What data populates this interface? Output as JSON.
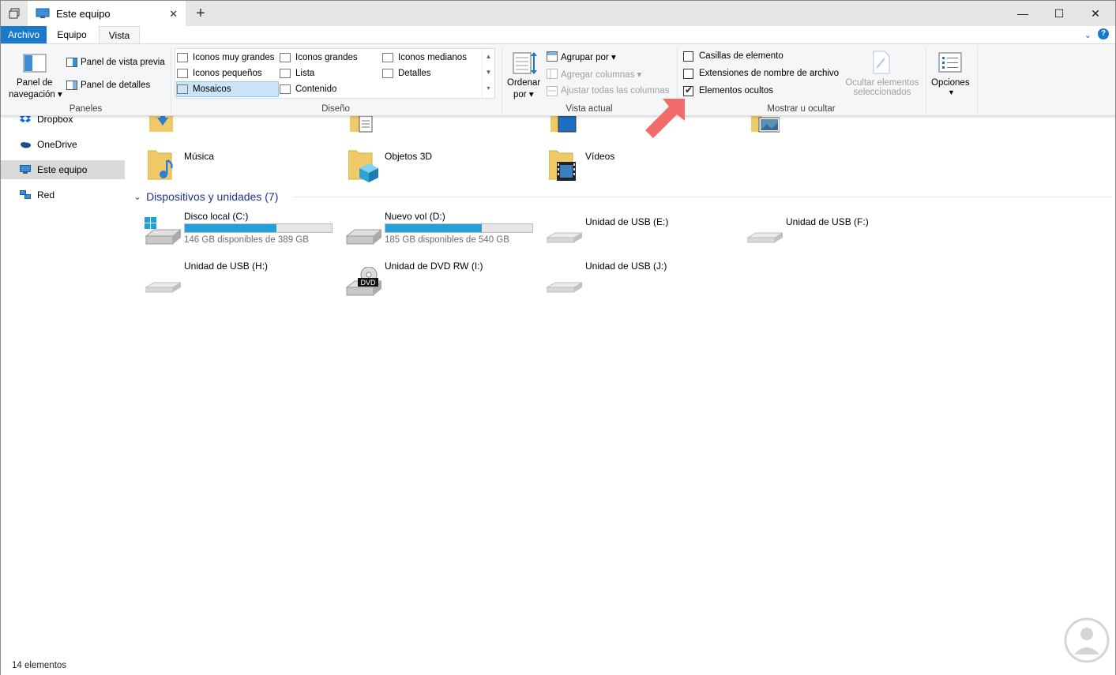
{
  "window": {
    "tab_title": "Este equipo"
  },
  "ribbon_tabs": {
    "archivo": "Archivo",
    "equipo": "Equipo",
    "vista": "Vista"
  },
  "panes": {
    "navigation_pane": "Panel de\nnavegación",
    "navigation_pane_line1": "Panel de",
    "navigation_pane_line2": "navegación",
    "preview_pane": "Panel de vista previa",
    "details_pane": "Panel de detalles",
    "group_label": "Paneles"
  },
  "layout": {
    "options": [
      "Iconos muy grandes",
      "Iconos grandes",
      "Iconos medianos",
      "Iconos pequeños",
      "Lista",
      "Detalles",
      "Mosaicos",
      "Contenido"
    ],
    "selected": "Mosaicos",
    "group_label": "Diseño"
  },
  "current_view": {
    "sort_line1": "Ordenar",
    "sort_line2": "por",
    "group_by": "Agrupar por",
    "add_columns": "Agregar columnas",
    "fit_columns": "Ajustar todas las columnas",
    "group_label": "Vista actual"
  },
  "show_hide": {
    "item_checkboxes": "Casillas de elemento",
    "item_checkboxes_checked": false,
    "file_extensions": "Extensiones de nombre de archivo",
    "file_extensions_checked": false,
    "hidden_items": "Elementos ocultos",
    "hidden_items_checked": true,
    "hide_selected_line1": "Ocultar elementos",
    "hide_selected_line2": "seleccionados",
    "group_label": "Mostrar u ocultar"
  },
  "options": {
    "label": "Opciones"
  },
  "nav_pane": {
    "items": [
      "Dropbox",
      "OneDrive",
      "Este equipo",
      "Red"
    ],
    "selected": "Este equipo"
  },
  "folders": [
    "Música",
    "Objetos 3D",
    "Vídeos"
  ],
  "devices": {
    "header": "Dispositivos y unidades (7)",
    "drives": [
      {
        "name": "Disco local (C:)",
        "free": "146 GB disponibles de 389 GB",
        "used_fraction": 0.625
      },
      {
        "name": "Nuevo vol (D:)",
        "free": "185 GB disponibles de 540 GB",
        "used_fraction": 0.657
      },
      {
        "name": "Unidad de USB (E:)"
      },
      {
        "name": "Unidad de USB (F:)"
      },
      {
        "name": "Unidad de USB (H:)"
      },
      {
        "name": "Unidad de DVD RW (I:)",
        "icon_label": "DVD"
      },
      {
        "name": "Unidad de USB (J:)"
      }
    ]
  },
  "status": {
    "count": "14 elementos"
  },
  "colors": {
    "accent": "#1979ca",
    "drive_bar": "#26a0da",
    "arrow": "#f26a6a"
  }
}
